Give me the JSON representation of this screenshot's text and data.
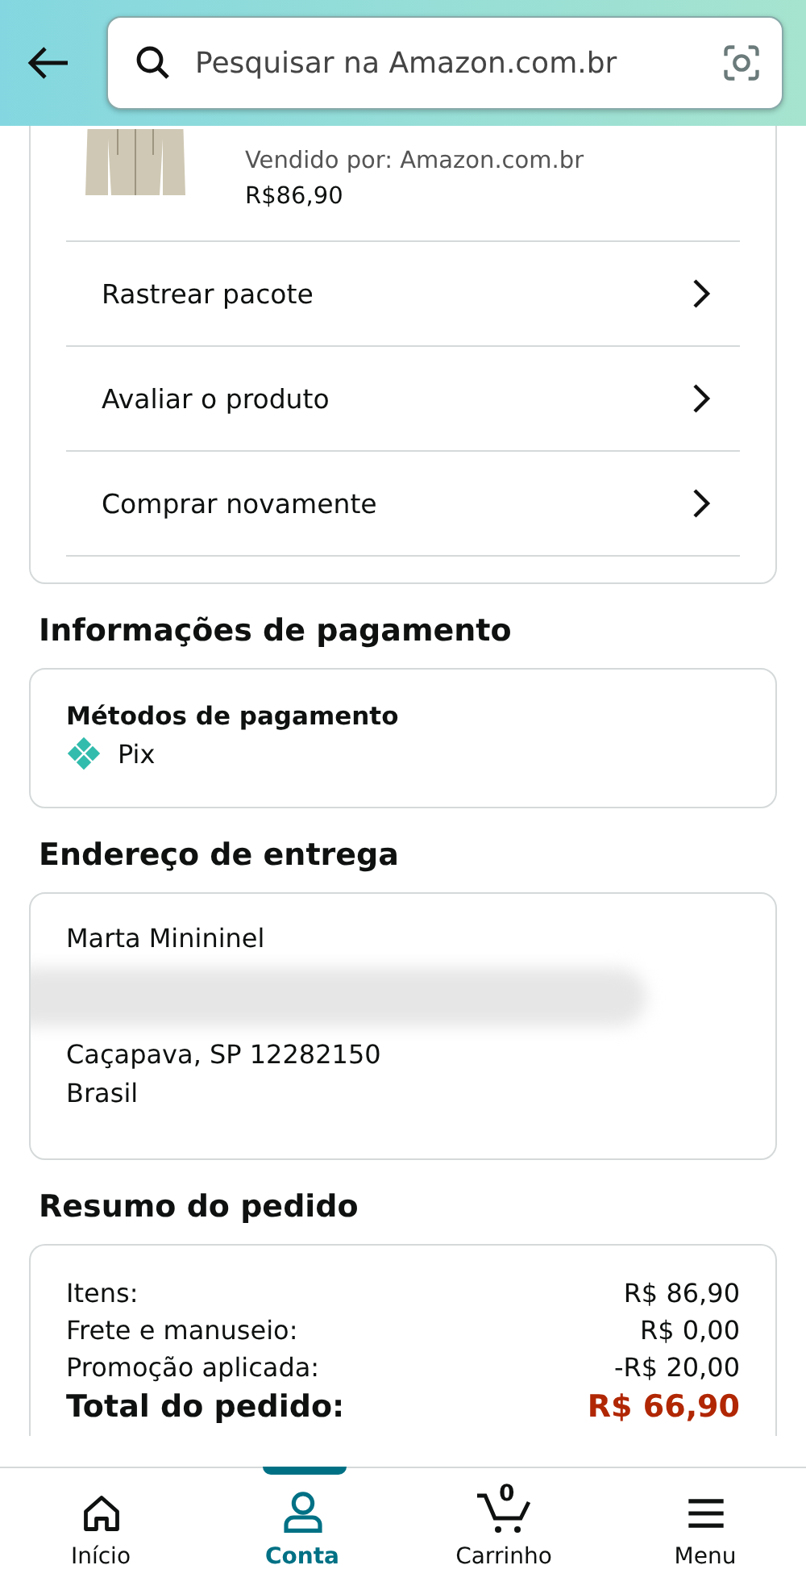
{
  "header": {
    "search": {
      "placeholder": "Pesquisar na Amazon.com.br"
    }
  },
  "product": {
    "seller": "Vendido por: Amazon.com.br",
    "price": "R$86,90"
  },
  "actions": [
    {
      "label": "Rastrear pacote"
    },
    {
      "label": "Avaliar o produto"
    },
    {
      "label": "Comprar novamente"
    }
  ],
  "payment": {
    "heading": "Informações de pagamento",
    "title": "Métodos de pagamento",
    "method": "Pix"
  },
  "address": {
    "heading": "Endereço de entrega",
    "lines": [
      "Marta Minininel",
      "Caçapava, SP 12282150",
      "Brasil"
    ]
  },
  "summary": {
    "heading": "Resumo do pedido",
    "rows": [
      {
        "label": "Itens:",
        "value": "R$ 86,90",
        "kind": "line"
      },
      {
        "label": "Frete e manuseio:",
        "value": "R$ 0,00",
        "kind": "line"
      },
      {
        "label": "Promoção aplicada:",
        "value": "-R$ 20,00",
        "kind": "line"
      },
      {
        "label": "Total do pedido:",
        "value": "R$ 66,90",
        "kind": "total"
      }
    ]
  },
  "nav": [
    {
      "label": "Início",
      "kind": "home",
      "selected": false
    },
    {
      "label": "Conta",
      "kind": "account",
      "selected": true
    },
    {
      "label": "Carrinho",
      "kind": "cart",
      "selected": false,
      "count": "0"
    },
    {
      "label": "Menu",
      "kind": "menu",
      "selected": false
    }
  ]
}
